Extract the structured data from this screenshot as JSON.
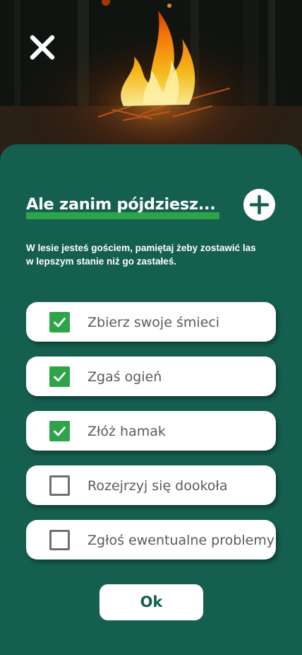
{
  "header": {
    "close_icon": "close-icon",
    "background": "campfire-photo"
  },
  "dialog": {
    "title": "Ale zanim pójdziesz...",
    "add_icon": "plus-icon",
    "intro": "W lesie jesteś gościem, pamiętaj żeby zostawić las w lepszym stanie niż go zastałeś.",
    "items": [
      {
        "label": "Zbierz swoje śmieci",
        "checked": true
      },
      {
        "label": "Zgaś ogień",
        "checked": true
      },
      {
        "label": "Złóż hamak",
        "checked": true
      },
      {
        "label": "Rozejrzyj się dookoła",
        "checked": false
      },
      {
        "label": "Zgłoś ewentualne problemy",
        "checked": false
      }
    ],
    "ok_label": "Ok"
  },
  "colors": {
    "sheet_background": "#155f4f",
    "accent_green": "#2ea44a",
    "checkbox_border": "#6f6f6f",
    "label_text": "#5b5b5b",
    "white": "#ffffff"
  }
}
